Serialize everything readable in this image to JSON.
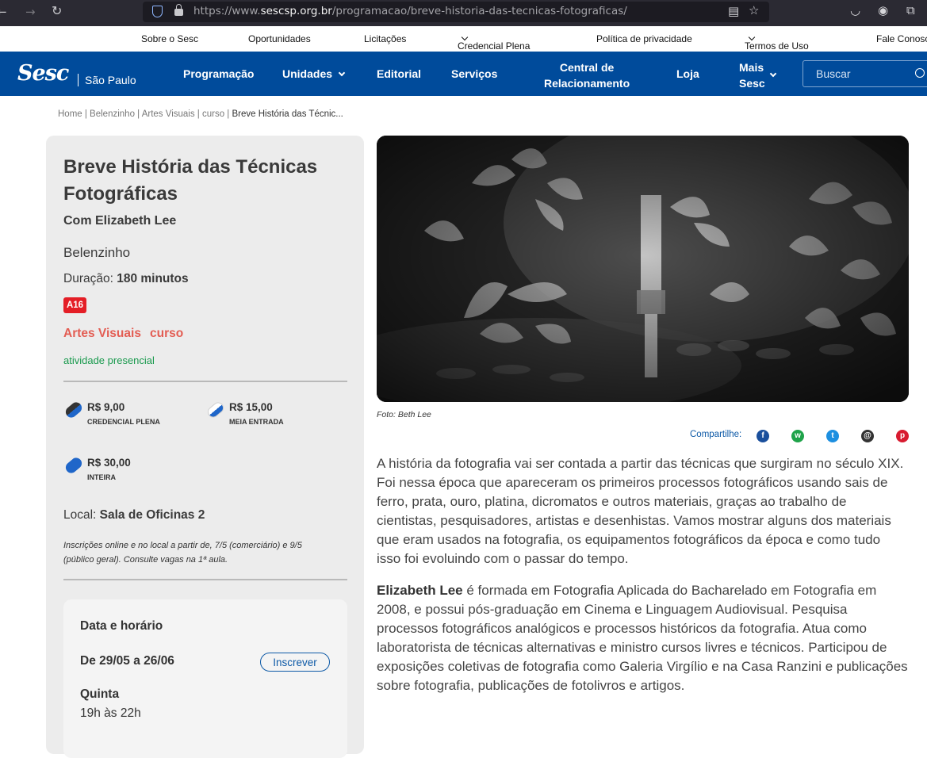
{
  "browser": {
    "url_prefix": "https://www.",
    "url_host": "sescsp.org.br",
    "url_path": "/programacao/breve-historia-das-tecnicas-fotograficas/"
  },
  "utility_nav": {
    "items": [
      {
        "label": "Sobre o Sesc"
      },
      {
        "label": "Oportunidades"
      },
      {
        "label": "Licitações"
      },
      {
        "label": "Credencial Plena"
      },
      {
        "label": "Política de privacidade"
      },
      {
        "label": "Termos de Uso"
      },
      {
        "label": "Fale Conosco"
      }
    ]
  },
  "header": {
    "logo": "Sesc",
    "city": "São Paulo",
    "nav": [
      {
        "label": "Programação"
      },
      {
        "label": "Unidades"
      },
      {
        "label": "Editorial"
      },
      {
        "label": "Serviços"
      },
      {
        "label_line1": "Central de",
        "label_line2": "Relacionamento"
      },
      {
        "label": "Loja"
      },
      {
        "label_line1": "Mais",
        "label_line2": "Sesc"
      }
    ],
    "search_placeholder": "Buscar"
  },
  "breadcrumb": {
    "path": "Home | Belenzinho | Artes Visuais | curso | ",
    "current": "Breve História das Técnic..."
  },
  "event": {
    "title": "Breve História das Técnicas Fotográficas",
    "subtitle": "Com Elizabeth Lee",
    "unit": "Belenzinho",
    "duration_label": "Duração: ",
    "duration_value": "180 minutos",
    "age_rating": "A16",
    "category": "Artes Visuais",
    "type": "curso",
    "modality": "atividade presencial",
    "prices": [
      {
        "value": "R$ 9,00",
        "label": "CREDENCIAL PLENA",
        "color": "#1f66c9"
      },
      {
        "value": "R$ 15,00",
        "label": "MEIA ENTRADA",
        "color": "#1f66c9"
      },
      {
        "value": "R$ 30,00",
        "label": "INTEIRA",
        "color": "#1f66c9"
      }
    ],
    "local_label": "Local: ",
    "local_value": "Sala de Oficinas 2",
    "note": "Inscrições online e no local a partir de, 7/5 (comerciário) e 9/5 (público geral). Consulte vagas na 1ª aula.",
    "schedule": {
      "title": "Data e horário",
      "range": "De 29/05 a 26/06",
      "button": "Inscrever",
      "day": "Quinta",
      "time": "19h às 22h"
    }
  },
  "photo": {
    "caption": "Foto: Beth Lee"
  },
  "share": {
    "label": "Compartilhe:",
    "icons": [
      {
        "name": "facebook-icon",
        "glyph": "f",
        "color": "#1a4f9c"
      },
      {
        "name": "whatsapp-icon",
        "glyph": "w",
        "color": "#1fa34a"
      },
      {
        "name": "twitter-icon",
        "glyph": "t",
        "color": "#1d8fe0"
      },
      {
        "name": "email-icon",
        "glyph": "@",
        "color": "#333333"
      },
      {
        "name": "pinterest-icon",
        "glyph": "p",
        "color": "#d81b30"
      }
    ]
  },
  "description": {
    "paragraph1": "A história da fotografia vai ser contada a partir das técnicas que surgiram no século XIX. Foi nessa época que apareceram os primeiros processos fotográficos usando sais de ferro, prata, ouro, platina, dicromatos e outros materiais, graças ao trabalho de cientistas, pesquisadores, artistas e desenhistas. Vamos mostrar alguns dos materiais que eram usados na fotografia, os equipamentos fotográficos da época e como tudo isso foi evoluindo com o passar do tempo.",
    "paragraph2_name": "Elizabeth Lee",
    "paragraph2_rest": " é formada em Fotografia Aplicada do Bacharelado em Fotografia em 2008, e possui pós-graduação em Cinema e Linguagem Audiovisual. Pesquisa processos fotográficos analógicos e processos históricos da fotografia. Atua como laboratorista de técnicas alternativas e ministro cursos livres e técnicos. Participou de exposições coletivas de fotografia como Galeria Virgílio e na Casa Ranzini e publicações sobre fotografia, publicações de fotolivros e artigos."
  }
}
